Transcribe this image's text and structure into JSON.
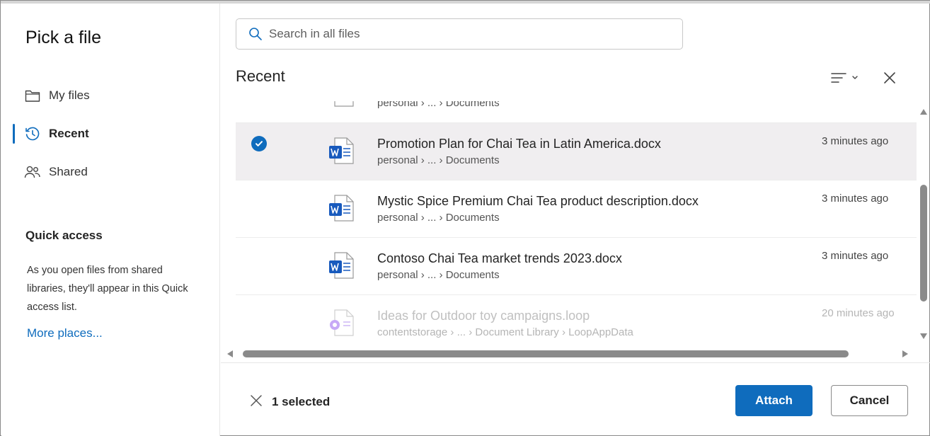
{
  "dialog": {
    "title": "Pick a file"
  },
  "nav": {
    "items": [
      {
        "label": "My files",
        "icon": "folder-icon",
        "active": false
      },
      {
        "label": "Recent",
        "icon": "history-icon",
        "active": true
      },
      {
        "label": "Shared",
        "icon": "people-icon",
        "active": false
      }
    ]
  },
  "quick_access": {
    "title": "Quick access",
    "text": "As you open files from shared libraries, they'll appear in this Quick access list.",
    "more_label": "More places..."
  },
  "search": {
    "placeholder": "Search in all files",
    "value": ""
  },
  "section": {
    "title": "Recent"
  },
  "toolbar": {
    "sort_icon": "sort-lines-icon",
    "close_icon": "close-icon"
  },
  "files": [
    {
      "name": "",
      "path": "personal › ... › Documents",
      "time": "",
      "type": "word",
      "selected": false,
      "dim": false
    },
    {
      "name": "Promotion Plan for Chai Tea in Latin America.docx",
      "path": "personal › ... › Documents",
      "time": "3 minutes ago",
      "type": "word",
      "selected": true,
      "dim": false
    },
    {
      "name": "Mystic Spice Premium Chai Tea product description.docx",
      "path": "personal › ... › Documents",
      "time": "3 minutes ago",
      "type": "word",
      "selected": false,
      "dim": false
    },
    {
      "name": "Contoso Chai Tea market trends 2023.docx",
      "path": "personal › ... › Documents",
      "time": "3 minutes ago",
      "type": "word",
      "selected": false,
      "dim": false
    },
    {
      "name": "Ideas for Outdoor toy campaigns.loop",
      "path": "contentstorage › ... › Document Library › LoopAppData",
      "time": "20 minutes ago",
      "type": "loop",
      "selected": false,
      "dim": true
    }
  ],
  "footer": {
    "selected_count": "1 selected",
    "attach_label": "Attach",
    "cancel_label": "Cancel"
  },
  "colors": {
    "accent": "#0f6cbd",
    "word_blue": "#185abd",
    "loop_purple": "#a77ff0"
  }
}
